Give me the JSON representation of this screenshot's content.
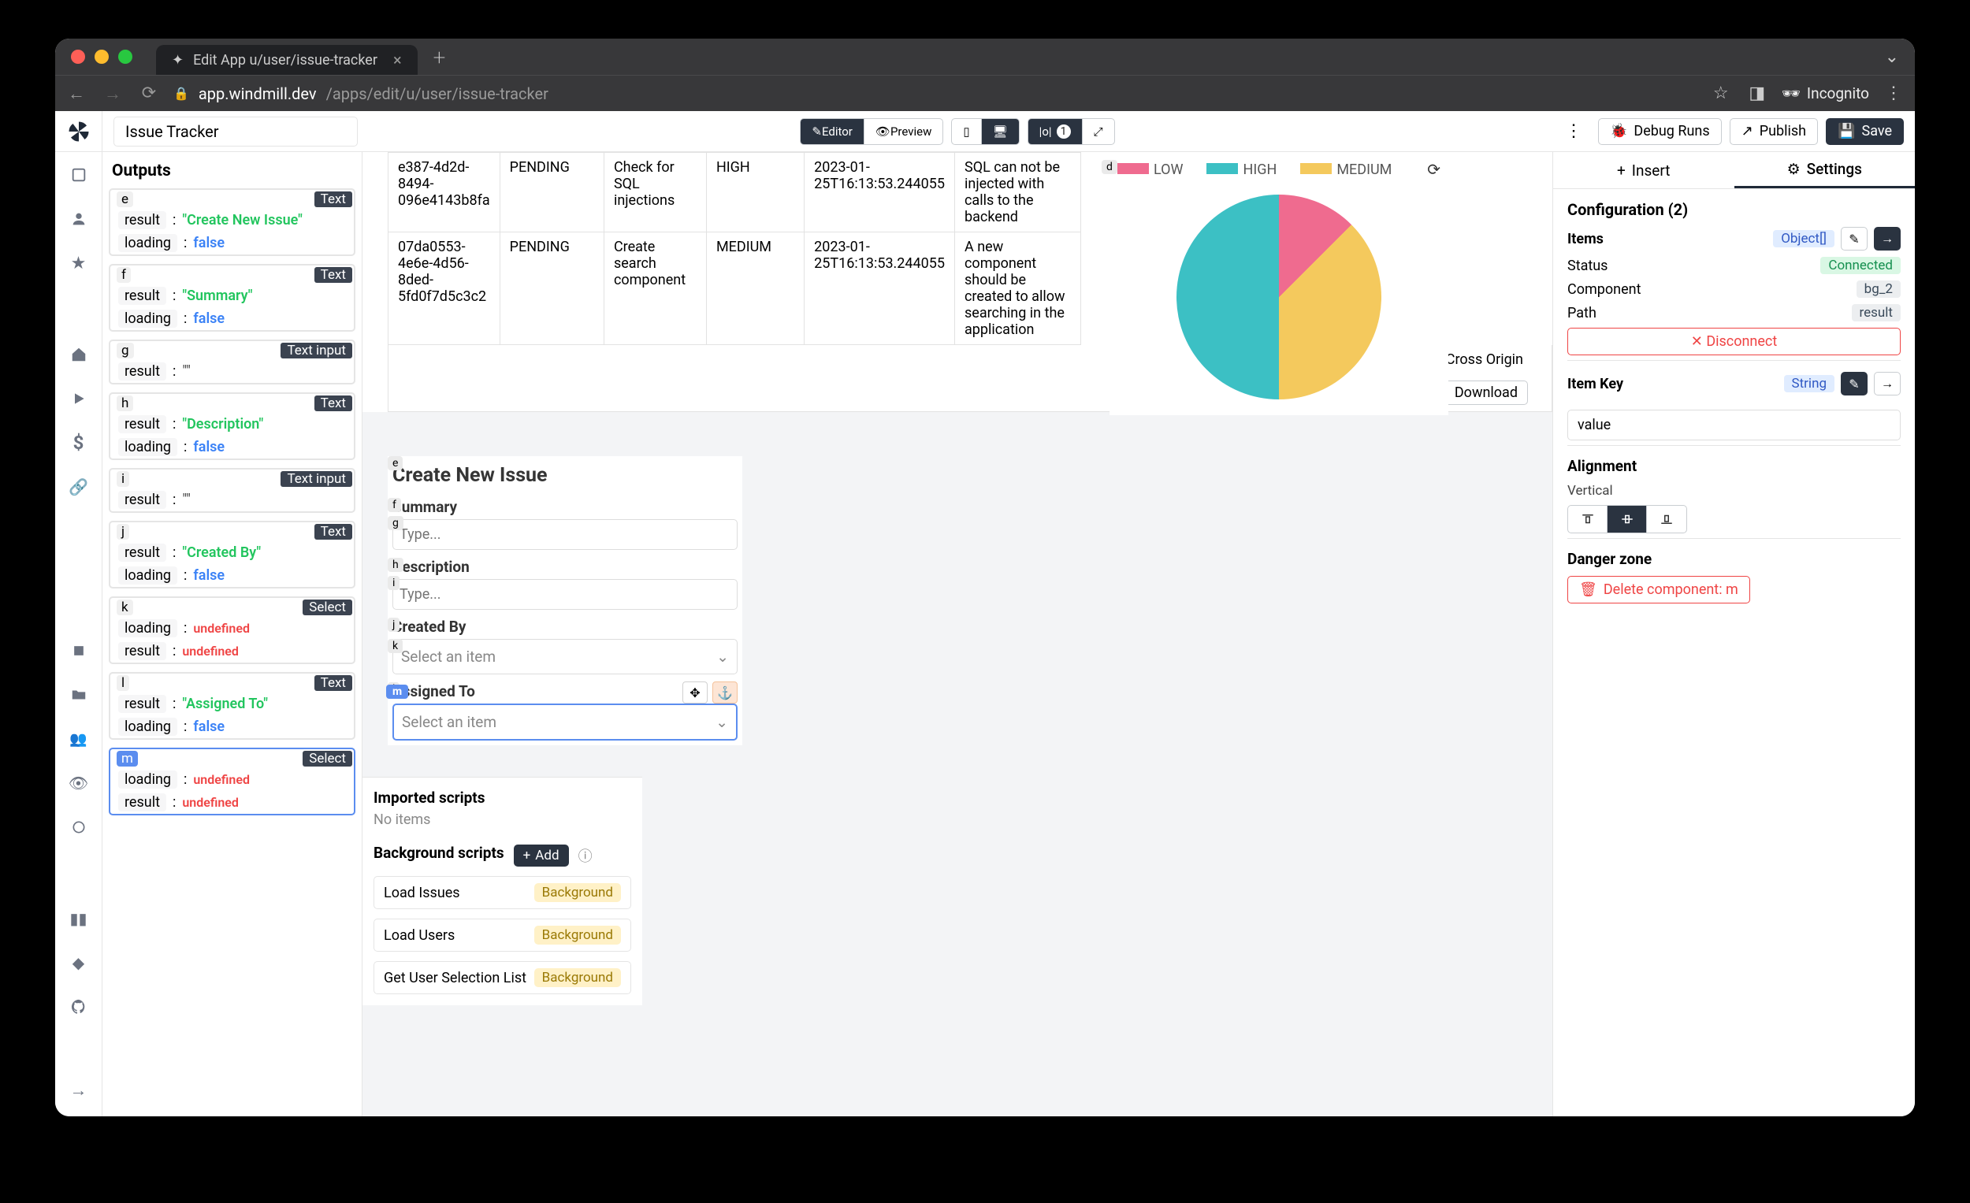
{
  "browser": {
    "tab_title": "Edit App u/user/issue-tracker",
    "url_host": "app.windmill.dev",
    "url_path": "/apps/edit/u/user/issue-tracker",
    "incognito_label": "Incognito"
  },
  "header": {
    "app_name": "Issue Tracker",
    "editor": "Editor",
    "preview": "Preview",
    "width_badge": "1",
    "more_menu": "⋮",
    "debug_runs": "Debug Runs",
    "publish": "Publish",
    "save": "Save"
  },
  "outputs": {
    "title": "Outputs",
    "blocks": [
      {
        "id": "e",
        "type": "Text",
        "rows": [
          {
            "k": "result",
            "v": "\"Create New Issue\"",
            "cls": "v-green"
          },
          {
            "k": "loading",
            "v": "false",
            "cls": "v-blue"
          }
        ]
      },
      {
        "id": "f",
        "type": "Text",
        "rows": [
          {
            "k": "result",
            "v": "\"Summary\"",
            "cls": "v-green"
          },
          {
            "k": "loading",
            "v": "false",
            "cls": "v-blue"
          }
        ]
      },
      {
        "id": "g",
        "type": "Text input",
        "rows": [
          {
            "k": "result",
            "v": "\"\"",
            "cls": "v-gray"
          }
        ]
      },
      {
        "id": "h",
        "type": "Text",
        "rows": [
          {
            "k": "result",
            "v": "\"Description\"",
            "cls": "v-green"
          },
          {
            "k": "loading",
            "v": "false",
            "cls": "v-blue"
          }
        ]
      },
      {
        "id": "i",
        "type": "Text input",
        "rows": [
          {
            "k": "result",
            "v": "\"\"",
            "cls": "v-gray"
          }
        ]
      },
      {
        "id": "j",
        "type": "Text",
        "rows": [
          {
            "k": "result",
            "v": "\"Created By\"",
            "cls": "v-green"
          },
          {
            "k": "loading",
            "v": "false",
            "cls": "v-blue"
          }
        ]
      },
      {
        "id": "k",
        "type": "Select",
        "rows": [
          {
            "k": "loading",
            "v": "undefined",
            "cls": "v-red"
          },
          {
            "k": "result",
            "v": "undefined",
            "cls": "v-red"
          }
        ]
      },
      {
        "id": "l",
        "type": "Text",
        "rows": [
          {
            "k": "result",
            "v": "\"Assigned To\"",
            "cls": "v-green"
          },
          {
            "k": "loading",
            "v": "false",
            "cls": "v-blue"
          }
        ]
      },
      {
        "id": "m",
        "type": "Select",
        "selected": true,
        "rows": [
          {
            "k": "loading",
            "v": "undefined",
            "cls": "v-red"
          },
          {
            "k": "result",
            "v": "undefined",
            "cls": "v-red"
          }
        ]
      }
    ]
  },
  "table": {
    "rows": [
      {
        "id": "e387-4d2d-8494-096e4143b8fa",
        "status": "PENDING",
        "summary": "Check for SQL injections",
        "severity": "HIGH",
        "date": "2023-01-25T16:13:53.244055",
        "desc": "SQL can not be injected with calls to the backend"
      },
      {
        "id": "07da0553-4e6e-4d56-8ded-5fd0f7d5c3c2",
        "status": "PENDING",
        "summary": "Create search component",
        "severity": "MEDIUM",
        "date": "2023-01-25T16:13:53.244055",
        "desc": "A new component should be created to allow searching in the application"
      }
    ],
    "tail": "A Cross Origin",
    "download": "Download"
  },
  "chart_data": {
    "type": "pie",
    "title": "",
    "series": [
      {
        "name": "LOW",
        "value": 50,
        "color": "#3cc0c4"
      },
      {
        "name": "HIGH",
        "value": 12.5,
        "color": "#ef6b8f"
      },
      {
        "name": "MEDIUM",
        "value": 37.5,
        "color": "#f4c95d"
      }
    ],
    "legend": [
      "LOW",
      "HIGH",
      "MEDIUM"
    ],
    "panel_id": "d"
  },
  "form": {
    "panel_e": "e",
    "title": "Create New Issue",
    "panel_f": "f",
    "summary_label": "Summary",
    "panel_g": "g",
    "summary_placeholder": "Type...",
    "panel_h": "h",
    "description_label": "Description",
    "panel_i": "i",
    "description_placeholder": "Type...",
    "panel_j": "j",
    "created_by_label": "Created By",
    "panel_k": "k",
    "created_by_placeholder": "Select an item",
    "panel_l": "l",
    "assigned_to_label": "Assigned To",
    "panel_m": "m",
    "assigned_to_placeholder": "Select an item"
  },
  "scripts": {
    "imported_title": "Imported scripts",
    "no_items": "No items",
    "bg_title": "Background scripts",
    "add": "Add",
    "rows": [
      {
        "name": "Load Issues",
        "badge": "Background"
      },
      {
        "name": "Load Users",
        "badge": "Background"
      },
      {
        "name": "Get User Selection List",
        "badge": "Background"
      }
    ]
  },
  "right": {
    "insert_tab": "Insert",
    "settings_tab": "Settings",
    "config_title": "Configuration (2)",
    "items_label": "Items",
    "items_type": "Object[]",
    "status_label": "Status",
    "status_value": "Connected",
    "component_label": "Component",
    "component_value": "bg_2",
    "path_label": "Path",
    "path_value": "result",
    "disconnect": "✕ Disconnect",
    "item_key_label": "Item Key",
    "item_key_type": "String",
    "item_key_value": "value",
    "alignment_title": "Alignment",
    "vertical_label": "Vertical",
    "danger_title": "Danger zone",
    "delete_label": "Delete component: m"
  }
}
